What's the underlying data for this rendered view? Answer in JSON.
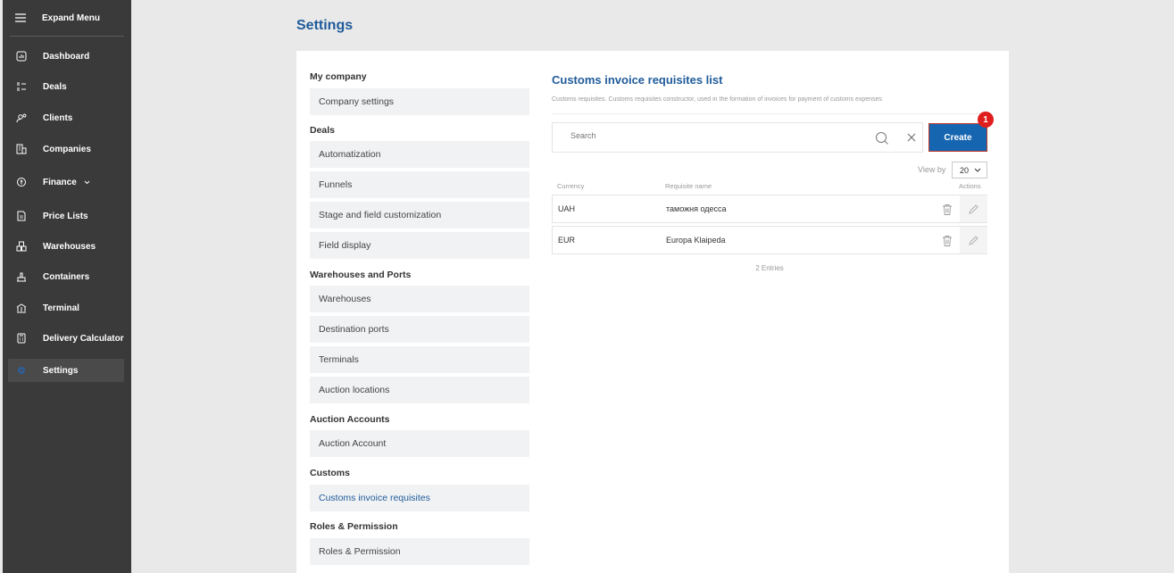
{
  "sidebar": {
    "expand_label": "Expand Menu",
    "items": [
      {
        "label": "Dashboard"
      },
      {
        "label": "Deals"
      },
      {
        "label": "Clients"
      },
      {
        "label": "Companies"
      },
      {
        "label": "Finance"
      },
      {
        "label": "Price Lists"
      },
      {
        "label": "Warehouses"
      },
      {
        "label": "Containers"
      },
      {
        "label": "Terminal"
      },
      {
        "label": "Delivery Calculator"
      },
      {
        "label": "Settings"
      }
    ]
  },
  "page": {
    "title": "Settings"
  },
  "settings_nav": {
    "groups": [
      {
        "title": "My company",
        "items": [
          "Company settings"
        ]
      },
      {
        "title": "Deals",
        "items": [
          "Automatization",
          "Funnels",
          "Stage and field customization",
          "Field display"
        ]
      },
      {
        "title": "Warehouses and Ports",
        "items": [
          "Warehouses",
          "Destination ports",
          "Terminals",
          "Auction locations"
        ]
      },
      {
        "title": "Auction Accounts",
        "items": [
          "Auction Account"
        ]
      },
      {
        "title": "Customs",
        "items": [
          "Customs invoice requisites"
        ]
      },
      {
        "title": "Roles & Permission",
        "items": [
          "Roles & Permission"
        ]
      }
    ]
  },
  "content": {
    "title": "Customs invoice requisites list",
    "description": "Customs requisites. Customs requisites constructor, used in the formation of invoices for payment of customs expenses",
    "search_placeholder": "Search",
    "create_label": "Create",
    "badge": "1",
    "view_by_label": "View by",
    "view_by_value": "20",
    "columns": {
      "currency": "Currency",
      "name": "Requisite name",
      "actions": "Actions"
    },
    "rows": [
      {
        "currency": "UAH",
        "name": "таможня одесса"
      },
      {
        "currency": "EUR",
        "name": "Europa Klaipeda"
      }
    ],
    "entries": "2 Entries"
  },
  "colors": {
    "accent": "#1f5b9a",
    "button": "#1565b0",
    "sidebar": "#3a3a3a",
    "badge": "#e01e1e"
  }
}
